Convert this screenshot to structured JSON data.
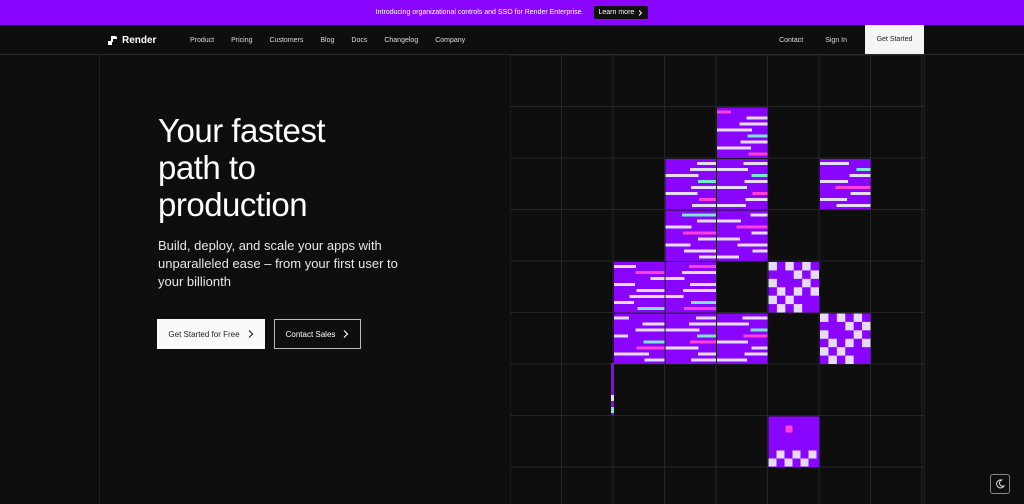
{
  "banner": {
    "text": "Introducing organizational controls and SSO for Render Enterprise.",
    "button_label": "Learn more"
  },
  "nav": {
    "logo_text": "Render",
    "links": [
      "Product",
      "Pricing",
      "Customers",
      "Blog",
      "Docs",
      "Changelog",
      "Company"
    ],
    "contact": "Contact",
    "sign_in": "Sign In",
    "get_started": "Get Started"
  },
  "hero": {
    "title_lines": [
      "Your fastest",
      "path to",
      "production"
    ],
    "subtitle": "Build, deploy, and scale your apps with unparalleled ease – from your first user to your billionth",
    "primary_button": "Get Started for Free",
    "secondary_button": "Contact Sales"
  },
  "colors": {
    "accent": "#8a05ff",
    "background": "#0e0e0e",
    "tile_light": "#e6dcf5",
    "tile_pink": "#ff3fd5",
    "tile_mint": "#77e9cf"
  },
  "icons": {
    "banner_arrow": "chevron-right-icon",
    "primary_arrow": "chevron-right-icon",
    "secondary_arrow": "chevron-right-icon",
    "theme": "moon-icon"
  }
}
